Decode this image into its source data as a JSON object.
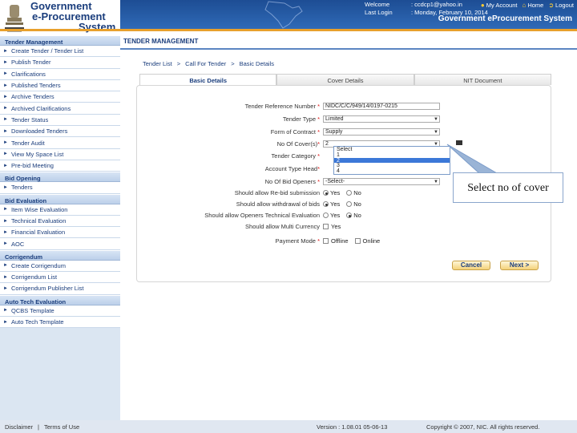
{
  "header": {
    "logo_line1": "Government",
    "logo_line2": "e-Procurement",
    "logo_line3": "System",
    "welcome_label": "Welcome",
    "welcome_value": ": ccdcp1@yahoo.in",
    "last_login_label": "Last Login",
    "last_login_value": ": Monday, February 10, 2014",
    "my_account": "My Account",
    "home": "Home",
    "logout": "Logout",
    "system_title": "Government eProcurement System",
    "brand_color": "#1d4d94",
    "accent_color": "#e8a02c"
  },
  "sidebar": {
    "sections": [
      {
        "title": "Tender Management",
        "items": [
          "Create Tender / Tender List",
          "Publish Tender",
          "Clarifications",
          "Published Tenders",
          "Archive Tenders",
          "Archived Clarifications",
          "Tender Status",
          "Downloaded Tenders",
          "Tender Audit",
          "View My Space List",
          "Pre-bid Meeting"
        ]
      },
      {
        "title": "Bid Opening",
        "items": [
          "Tenders"
        ]
      },
      {
        "title": "Bid Evaluation",
        "items": [
          "Item Wise Evaluation",
          "Technical Evaluation",
          "Financial Evaluation",
          "AOC"
        ]
      },
      {
        "title": "Corrigendum",
        "items": [
          "Create Corrigendum",
          "Corrigendum List",
          "Corrigendum Publisher List"
        ]
      },
      {
        "title": "Auto Tech Evaluation",
        "items": [
          "QCBS Template",
          "Auto Tech Template"
        ]
      }
    ]
  },
  "main": {
    "page_heading": "TENDER MANAGEMENT",
    "breadcrumb": [
      "Tender List",
      ">",
      "Call For Tender",
      ">",
      "Basic Details"
    ],
    "tabs": [
      "Basic Details",
      "Cover Details",
      "NIT Document"
    ],
    "active_tab": "Basic Details",
    "form": {
      "tender_ref_label": "Tender Reference Number",
      "tender_ref_value": "NIDC/C/C/949/14/0197-0215",
      "tender_type_label": "Tender Type",
      "tender_type_value": "Limited",
      "form_contract_label": "Form of Contract",
      "form_contract_value": "Supply",
      "covers_label": "No Of Cover(s)",
      "covers_value": "2",
      "covers_options": [
        "Select",
        "1",
        "2",
        "3",
        "4"
      ],
      "covers_highlighted": "2",
      "tender_category_label": "Tender Category",
      "account_type_label": "Account Type Head",
      "bid_openers_label": "No Of Bid Openers",
      "bid_openers_value": "-Select-",
      "rebid_label": "Should allow Re-bid submission",
      "withdrawal_label": "Should allow withdrawal of bids",
      "tech_eval_label": "Should allow Openers Technical Evaluation",
      "multi_currency_label": "Should allow Multi Currency",
      "payment_mode_label": "Payment Mode",
      "yes": "Yes",
      "no": "No",
      "offline": "Offline",
      "online": "Online",
      "cancel": "Cancel",
      "next": "Next >"
    }
  },
  "callout": {
    "text": "Select no of cover"
  },
  "footer": {
    "disclaimer": "Disclaimer",
    "separator": "|",
    "terms": "Terms of Use",
    "version": "Version : 1.08.01 05-06-13",
    "copyright": "Copyright © 2007, NIC. All rights reserved."
  }
}
